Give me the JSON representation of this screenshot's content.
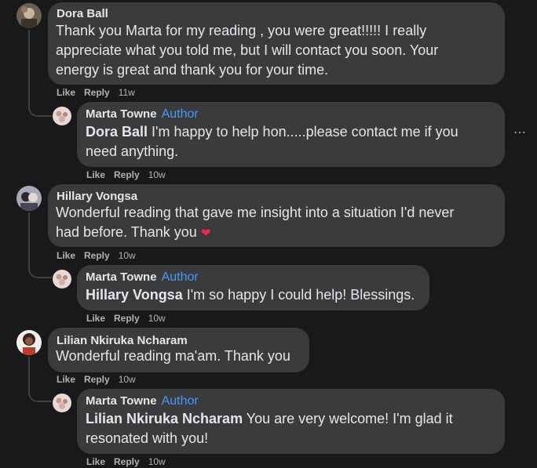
{
  "comments": [
    {
      "author": "Dora Ball",
      "text": [
        "Thank you Marta for my reading , you were great!!!!! I really",
        "appreciate what you told me, but I will contact you soon. Your",
        "energy is great and thank you for your time."
      ],
      "like_label": "Like",
      "reply_label": "Reply",
      "time": "11w",
      "reply": {
        "author": "Marta Towne",
        "badge": "Author",
        "mention": "Dora Ball",
        "text_line1": " I'm happy to help hon.....please contact me if you",
        "text_line2": "need anything.",
        "like_label": "Like",
        "reply_label": "Reply",
        "time": "10w"
      }
    },
    {
      "author": "Hillary Vongsa",
      "text": [
        "Wonderful reading that gave me insight into a situation I'd never",
        "had before. Thank you "
      ],
      "heart": "❤",
      "like_label": "Like",
      "reply_label": "Reply",
      "time": "10w",
      "reply": {
        "author": "Marta Towne",
        "badge": "Author",
        "mention": "Hillary Vongsa",
        "text_line1": " I'm so happy I could help! Blessings.",
        "like_label": "Like",
        "reply_label": "Reply",
        "time": "10w"
      }
    },
    {
      "author": "Lilian Nkiruka Ncharam",
      "text": [
        "Wonderful reading ma'am. Thank you"
      ],
      "like_label": "Like",
      "reply_label": "Reply",
      "time": "10w",
      "reply": {
        "author": "Marta Towne",
        "badge": "Author",
        "mention": "Lilian Nkiruka Ncharam",
        "text_line1": " You are very welcome! I'm glad it",
        "text_line2": "resonated with you!",
        "like_label": "Like",
        "reply_label": "Reply",
        "time": "10w"
      }
    }
  ],
  "more_icon": "⋯",
  "colors": {
    "background": "#18191a",
    "bubble": "#3a3b3c",
    "text": "#e4e6eb",
    "secondary": "#b0b3b8",
    "author_badge": "#4599ff",
    "heart": "#f02849"
  }
}
